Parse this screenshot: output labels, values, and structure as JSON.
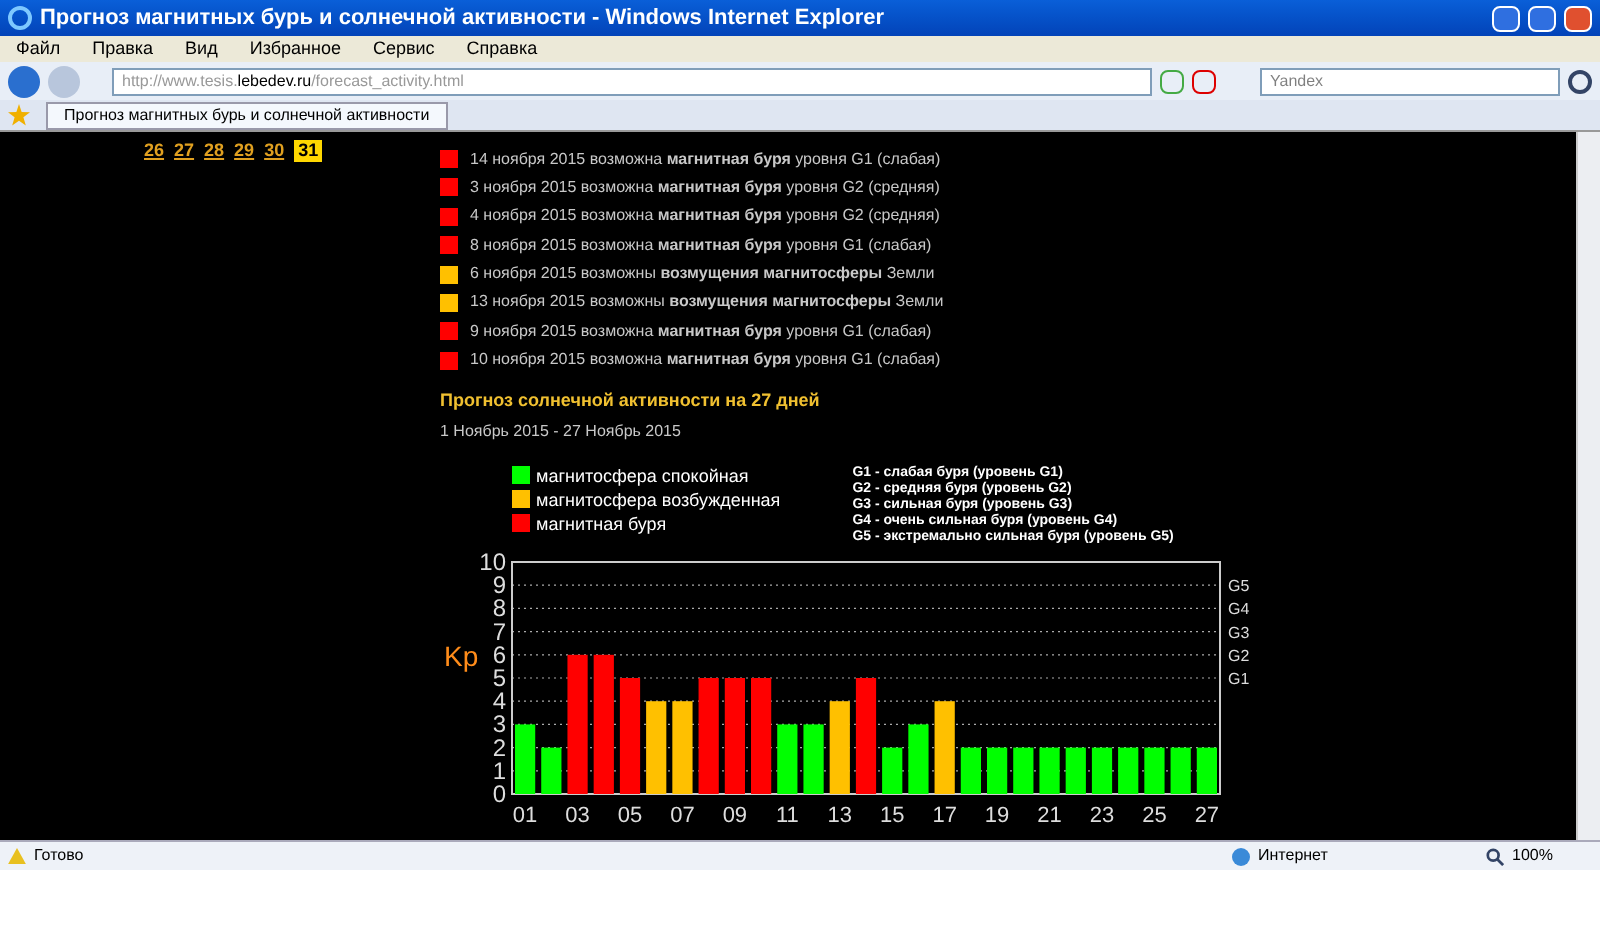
{
  "window": {
    "title": "Прогноз магнитных бурь и солнечной активности - Windows Internet Explorer"
  },
  "menu": [
    "Файл",
    "Правка",
    "Вид",
    "Избранное",
    "Сервис",
    "Справка"
  ],
  "address": {
    "prefix": "http://www.tesis.",
    "domain": "lebedev.ru",
    "path": "/forecast_activity.html"
  },
  "search": {
    "placeholder": "Yandex"
  },
  "tab": {
    "title": "Прогноз магнитных бурь и солнечной активности"
  },
  "calendar": [
    {
      "day": "26",
      "selected": false
    },
    {
      "day": "27",
      "selected": false
    },
    {
      "day": "28",
      "selected": false
    },
    {
      "day": "29",
      "selected": false
    },
    {
      "day": "30",
      "selected": false
    },
    {
      "day": "31",
      "selected": true
    }
  ],
  "forecasts": [
    {
      "color": "#ff0000",
      "text": "14 ноября 2015 возможна **магнитная буря** уровня G1 (слабая)"
    },
    {
      "color": "#ff0000",
      "text": "3 ноября 2015 возможна **магнитная буря** уровня G2 (средняя)"
    },
    {
      "color": "#ff0000",
      "text": "4 ноября 2015 возможна **магнитная буря** уровня G2 (средняя)"
    },
    {
      "color": "#ff0000",
      "text": "8 ноября 2015 возможна **магнитная буря** уровня G1 (слабая)"
    },
    {
      "color": "#ffc000",
      "text": "6 ноября 2015 возможны **возмущения магнитосферы** Земли"
    },
    {
      "color": "#ffc000",
      "text": "13 ноября 2015 возможны **возмущения магнитосферы** Земли"
    },
    {
      "color": "#ff0000",
      "text": "9 ноября 2015 возможна **магнитная буря** уровня G1 (слабая)"
    },
    {
      "color": "#ff0000",
      "text": "10 ноября 2015 возможна **магнитная буря** уровня G1 (слабая)"
    }
  ],
  "solar": {
    "heading": "Прогноз солнечной активности на 27 дней",
    "period": "1 Ноябрь 2015 - 27 Ноябрь 2015",
    "storm_scale": [
      "G1 - слабая буря (уровень G1)",
      "G2 - средняя буря (уровень G2)",
      "G3 - сильная буря (уровень G3)",
      "G4 - очень сильная буря (уровень G4)",
      "G5 - экстремально сильная буря (уровень G5)"
    ],
    "right_axis": [
      "G5",
      "G4",
      "G3",
      "G2",
      "G1"
    ],
    "chart_data": {
      "type": "bar",
      "ylabel": "Kp",
      "x": [
        1,
        2,
        3,
        4,
        5,
        6,
        7,
        8,
        9,
        10,
        11,
        12,
        13,
        14,
        15,
        16,
        17,
        18,
        19,
        20,
        21,
        22,
        23,
        24,
        25,
        26,
        27
      ],
      "xlim": [
        0.5,
        27.5
      ],
      "grid": true,
      "xticks": [
        {
          "value": 1,
          "label": "01"
        },
        {
          "value": 3,
          "label": "03"
        },
        {
          "value": 5,
          "label": "05"
        },
        {
          "value": 7,
          "label": "07"
        },
        {
          "value": 9,
          "label": "09"
        },
        {
          "value": 11,
          "label": "11"
        },
        {
          "value": 13,
          "label": "13"
        },
        {
          "value": 15,
          "label": "15"
        },
        {
          "value": 17,
          "label": "17"
        },
        {
          "value": 19,
          "label": "19"
        },
        {
          "value": 21,
          "label": "21"
        },
        {
          "value": 23,
          "label": "23"
        },
        {
          "value": 25,
          "label": "25"
        },
        {
          "value": 27,
          "label": "27"
        }
      ],
      "ylim": [
        0,
        10
      ],
      "yticks": [
        0,
        1,
        2,
        3,
        4,
        5,
        6,
        7,
        8,
        9,
        10
      ],
      "series": [
        {
          "name": "магнитосфера спокойная",
          "color": "#00ff00",
          "values": [
            3,
            2,
            null,
            null,
            null,
            null,
            null,
            null,
            null,
            null,
            3,
            3,
            null,
            null,
            2,
            3,
            null,
            2,
            2,
            2,
            2,
            2,
            2,
            2,
            2,
            2,
            2
          ]
        },
        {
          "name": "магнитосфера возбужденная",
          "color": "#ffc000",
          "values": [
            null,
            null,
            null,
            null,
            null,
            4,
            4,
            null,
            null,
            null,
            null,
            null,
            4,
            null,
            null,
            null,
            4,
            null,
            null,
            null,
            null,
            null,
            null,
            null,
            null,
            null,
            null
          ]
        },
        {
          "name": "магнитная буря",
          "color": "#ff0000",
          "values": [
            null,
            null,
            6,
            6,
            5,
            null,
            null,
            5,
            5,
            5,
            null,
            null,
            null,
            5,
            null,
            null,
            null,
            null,
            null,
            null,
            null,
            null,
            null,
            null,
            null,
            null,
            null
          ]
        }
      ]
    }
  },
  "status_bar": {
    "status": "Готово",
    "zone": "Интернет",
    "zoom": "100%"
  }
}
